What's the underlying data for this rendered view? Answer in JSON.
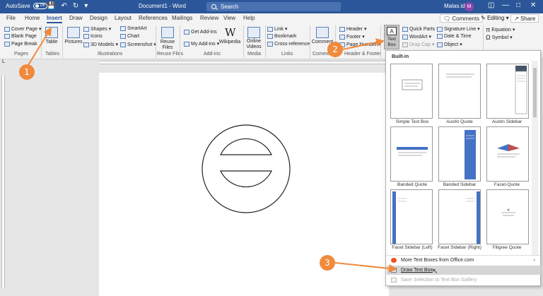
{
  "titlebar": {
    "autosave_label": "AutoSave",
    "autosave_state": "Off",
    "doc_title": "Document1 - Word",
    "search_placeholder": "Search",
    "user_name": "Malas.id",
    "user_initial": "M",
    "save_icon": "save-icon",
    "undo_icon": "undo-icon",
    "redo_icon": "redo-icon"
  },
  "tabs": [
    "File",
    "Home",
    "Insert",
    "Draw",
    "Design",
    "Layout",
    "References",
    "Mailings",
    "Review",
    "View",
    "Help"
  ],
  "active_tab": "Insert",
  "tab_buttons": {
    "comments": "Comments",
    "editing": "Editing",
    "share": "Share"
  },
  "ribbon": {
    "pages": {
      "cover_page": "Cover Page",
      "blank_page": "Blank Page",
      "page_break": "Page Break",
      "label": "Pages"
    },
    "tables": {
      "table": "Table",
      "label": "Tables"
    },
    "illustrations": {
      "pictures": "Pictures",
      "shapes": "Shapes",
      "icons": "Icons",
      "models": "3D Models",
      "smartart": "SmartArt",
      "chart": "Chart",
      "screenshot": "Screenshot",
      "label": "Illustrations"
    },
    "reuse": {
      "reuse_files": "Reuse Files",
      "label": "Reuse Files"
    },
    "addins": {
      "get_addins": "Get Add-ins",
      "my_addins": "My Add-ins",
      "wikipedia": "Wikipedia",
      "label": "Add-ins"
    },
    "media": {
      "online_videos": "Online Videos",
      "label": "Media"
    },
    "links": {
      "link": "Link",
      "bookmark": "Bookmark",
      "cross_reference": "Cross-reference",
      "label": "Links"
    },
    "comments": {
      "comment": "Comment",
      "label": "Comments"
    },
    "header_footer": {
      "header": "Header",
      "footer": "Footer",
      "page_number": "Page Number",
      "label": "Header & Footer"
    },
    "text": {
      "text_box": "Text Box",
      "quick_parts": "Quick Parts",
      "wordart": "WordArt",
      "drop_cap": "Drop Cap",
      "signature_line": "Signature Line",
      "date_time": "Date & Time",
      "object": "Object"
    },
    "symbols": {
      "equation": "Equation",
      "symbol": "Symbol"
    }
  },
  "gallery": {
    "section_title": "Built-in",
    "items": [
      "Simple Text Box",
      "Austin Quote",
      "Austin Sidebar",
      "Banded Quote",
      "Banded Sidebar",
      "Facet-Quote",
      "Facet Sidebar (Left)",
      "Facet Sidebar (Right)",
      "Filigree Quote"
    ],
    "more_label": "More Text Boxes from Office.com",
    "draw_label": "Draw Text Box",
    "save_label": "Save Selection to Text Box Gallery"
  },
  "callouts": [
    "1",
    "2",
    "3"
  ],
  "colors": {
    "word_blue": "#2b579a",
    "callout_orange": "#f08a3c",
    "tile_blue": "#4472c4"
  }
}
